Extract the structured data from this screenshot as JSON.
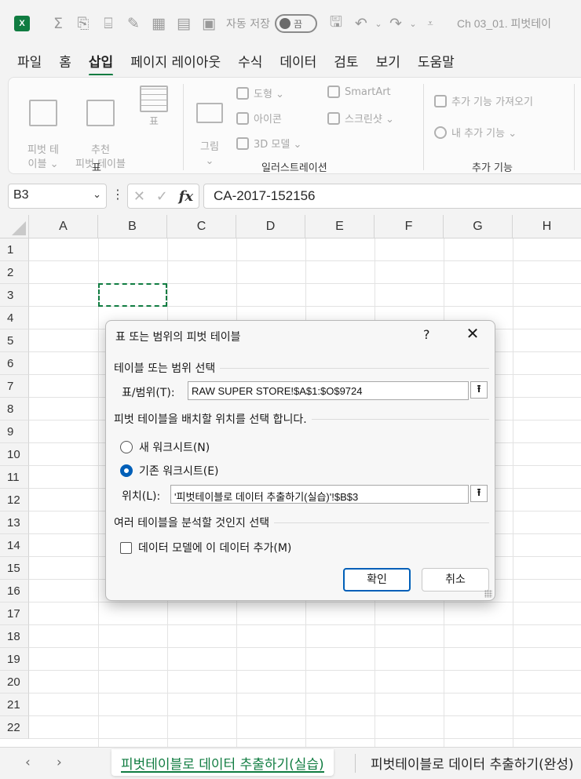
{
  "titlebar": {
    "app_badge": "X",
    "autosave_label": "자동 저장",
    "autosave_state": "끔",
    "doc_title": "Ch 03_01. 피벗테이"
  },
  "menu": {
    "items": [
      "파일",
      "홈",
      "삽입",
      "페이지 레이아웃",
      "수식",
      "데이터",
      "검토",
      "보기",
      "도움말"
    ],
    "active": "삽입"
  },
  "ribbon": {
    "pivot_table": "피벗 테\n이블 ⌄",
    "recommended_pivot": "추천\n피벗 테이블",
    "table": "표",
    "group_table": "표",
    "picture": "그림\n⌄",
    "shapes": "도형 ⌄",
    "icons": "아이콘",
    "models_3d": "3D 모델 ⌄",
    "smartart": "SmartArt",
    "screenshot": "스크린샷 ⌄",
    "group_illustrations": "일러스트레이션",
    "get_addins": "추가 기능 가져오기",
    "my_addins": "내 추가 기능 ⌄",
    "group_addins": "추가 기능"
  },
  "formula_bar": {
    "name_box": "B3",
    "formula": "CA-2017-152156"
  },
  "grid": {
    "columns": [
      "A",
      "B",
      "C",
      "D",
      "E",
      "F",
      "G",
      "H"
    ],
    "rows": [
      "1",
      "2",
      "3",
      "4",
      "5",
      "6",
      "7",
      "8",
      "9",
      "10",
      "11",
      "12",
      "13",
      "14",
      "15",
      "16",
      "17",
      "18",
      "19",
      "20",
      "21",
      "22"
    ]
  },
  "dialog": {
    "title": "표 또는 범위의 피벗 테이블",
    "help": "?",
    "close": "✕",
    "section_select": "테이블 또는 범위 선택",
    "range_label": "표/범위(T):",
    "range_value": "RAW SUPER STORE!$A$1:$O$9724",
    "section_place": "피벗 테이블을 배치할 위치를 선택 합니다.",
    "new_sheet": "새 워크시트(N)",
    "existing_sheet": "기존 워크시트(E)",
    "location_label": "위치(L):",
    "location_value": "'피벗테이블로 데이터 추출하기(실습)'!$B$3",
    "section_analyze": "여러 테이블을 분석할 것인지 선택",
    "data_model": "데이터 모델에 이 데이터 추가(M)",
    "ok": "확인",
    "cancel": "취소"
  },
  "sheets": {
    "tabs": [
      "피벗테이블로 데이터 추출하기(실습)",
      "피벗테이블로 데이터 추출하기(완성)"
    ],
    "active_index": 0
  },
  "colors": {
    "accent": "#107c41",
    "dialog_accent": "#005fb8"
  }
}
